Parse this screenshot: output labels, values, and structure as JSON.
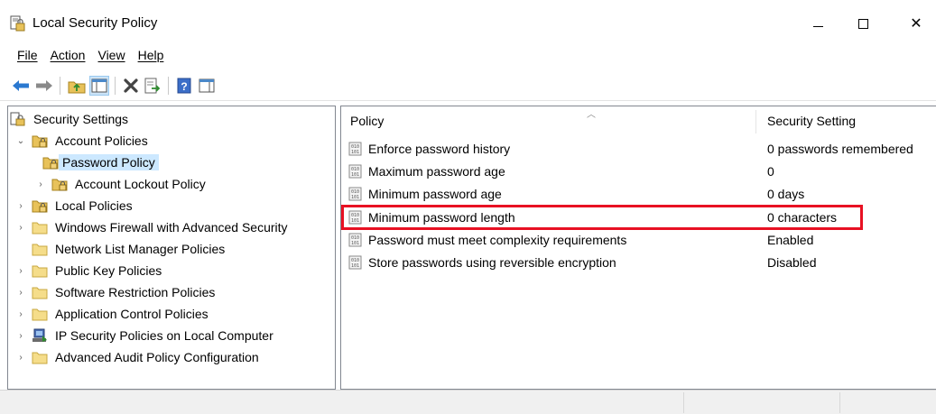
{
  "window": {
    "title": "Local Security Policy",
    "icon": "local-security-policy-icon",
    "controls": [
      "minimize",
      "maximize",
      "close"
    ],
    "close_glyph": "✕"
  },
  "menu": {
    "items": [
      "File",
      "Action",
      "View",
      "Help"
    ]
  },
  "toolbar": {
    "buttons": [
      "back",
      "forward",
      "up-folder",
      "show-hide-console-tree",
      "delete",
      "export-list",
      "help",
      "show-hide-action-pane"
    ]
  },
  "tree": {
    "root": "Security Settings",
    "nodes": [
      {
        "label": "Account Policies",
        "expanded": true,
        "level": 1
      },
      {
        "label": "Password Policy",
        "selected": true,
        "level": 2
      },
      {
        "label": "Account Lockout Policy",
        "level": 2
      },
      {
        "label": "Local Policies",
        "level": 1
      },
      {
        "label": "Windows Firewall with Advanced Security",
        "level": 1
      },
      {
        "label": "Network List Manager Policies",
        "level": 1
      },
      {
        "label": "Public Key Policies",
        "level": 1
      },
      {
        "label": "Software Restriction Policies",
        "level": 1
      },
      {
        "label": "Application Control Policies",
        "level": 1
      },
      {
        "label": "IP Security Policies on Local Computer",
        "level": 1
      },
      {
        "label": "Advanced Audit Policy Configuration",
        "level": 1
      }
    ]
  },
  "list": {
    "headers": {
      "policy": "Policy",
      "setting": "Security Setting"
    },
    "rows": [
      {
        "policy": "Enforce password history",
        "setting": "0 passwords remembered"
      },
      {
        "policy": "Maximum password age",
        "setting": "0"
      },
      {
        "policy": "Minimum password age",
        "setting": "0 days"
      },
      {
        "policy": "Minimum password length",
        "setting": "0 characters",
        "highlighted": true
      },
      {
        "policy": "Password must meet complexity requirements",
        "setting": "Enabled"
      },
      {
        "policy": "Store passwords using reversible encryption",
        "setting": "Disabled"
      }
    ]
  },
  "colors": {
    "selection": "#cce8ff",
    "highlight_border": "#e81123",
    "folder": "#e8c25a"
  }
}
